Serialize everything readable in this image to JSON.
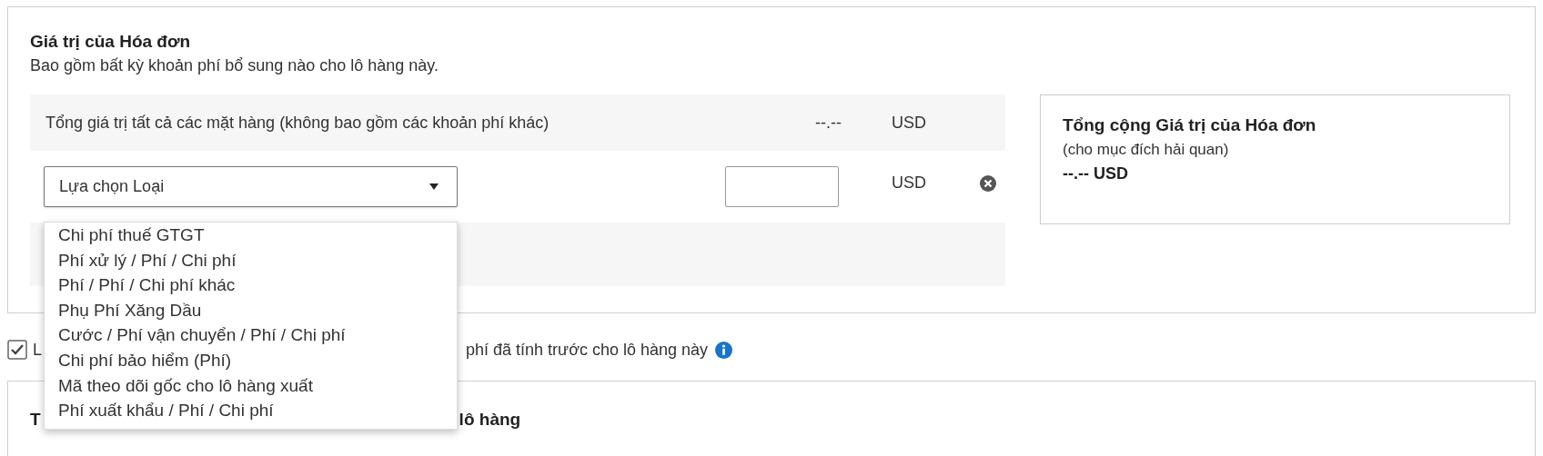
{
  "invoice_value": {
    "title": "Giá trị của Hóa đơn",
    "subtitle": "Bao gồm bất kỳ khoản phí bổ sung nào cho lô hàng này.",
    "items_total": {
      "label": "Tổng giá trị tất cả các mặt hàng (không bao gồm các khoản phí khác)",
      "value": "--.--",
      "currency": "USD"
    },
    "charge": {
      "select": {
        "value": "Lựa chọn Loại",
        "expanded": true
      },
      "currency": "USD"
    },
    "summary": {
      "title": "Tổng cộng Giá trị của Hóa đơn",
      "note": "(cho mục đích hải quan)",
      "total": "--.-- USD"
    }
  },
  "dropdown_options": [
    {
      "label": "Chi phí thuế GTGT"
    },
    {
      "label": "Phí xử lý / Phí / Chi phí"
    },
    {
      "label": "Phí / Phí / Chi phí khác"
    },
    {
      "label": "Phụ Phí Xăng Dầu"
    },
    {
      "label": "Cước / Phí vận chuyển / Phí / Chi phí"
    },
    {
      "label": "Chi phí bảo hiểm (Phí)"
    },
    {
      "label": "Mã theo dõi gốc cho lô hàng xuất"
    },
    {
      "label": "Phí xuất khẩu / Phí / Chi phí"
    }
  ],
  "prepaid": {
    "checked": true,
    "label_start": "L",
    "label_end": "phí đã tính trước cho lô hàng này"
  },
  "next_section": {
    "title_start": "T",
    "title_end": "lô hàng"
  }
}
